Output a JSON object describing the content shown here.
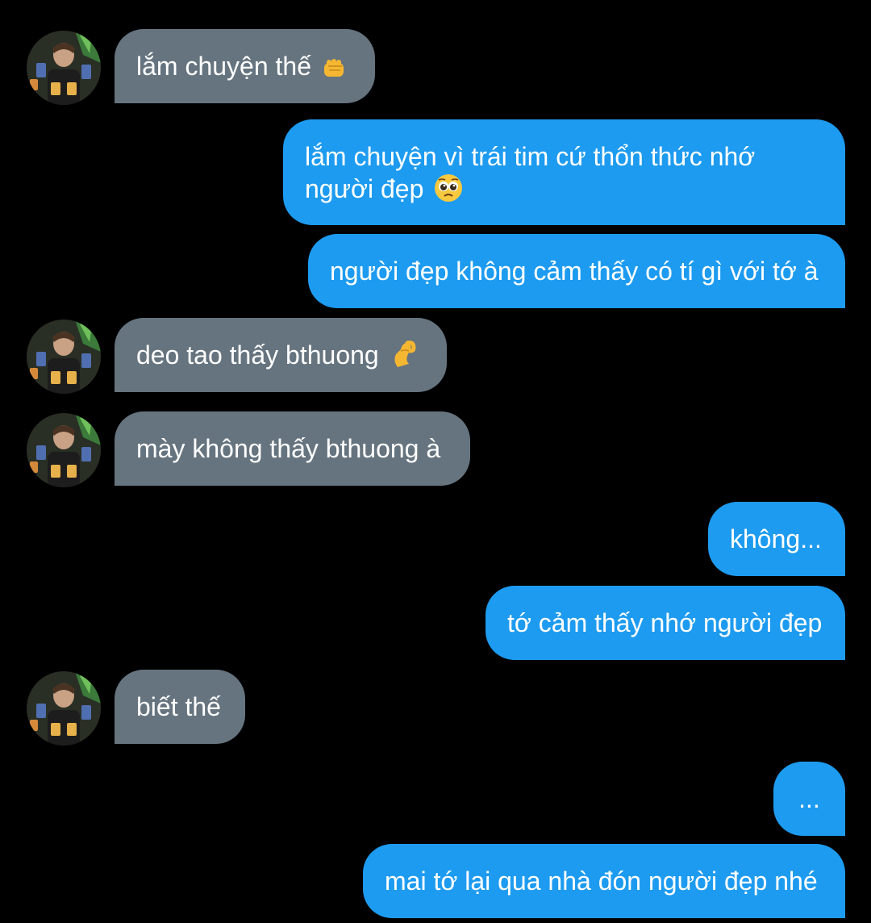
{
  "theme": {
    "background": "#000000",
    "sent_bubble_color": "#1d9bf0",
    "received_bubble_color": "#66747f",
    "text_color": "#ffffff"
  },
  "messages": [
    {
      "from": "them",
      "text": "lắm chuyện thế",
      "emoji": "fist-icon"
    },
    {
      "from": "me",
      "line1": "lắm chuyện vì trái tim cứ thổn thức nhớ",
      "line2": "người đẹp",
      "emoji": "pleading-face-icon"
    },
    {
      "from": "me",
      "text": "người đẹp không cảm thấy có tí gì với tớ à"
    },
    {
      "from": "them",
      "text": "deo tao thấy bthuong",
      "emoji": "pinching-hand-icon"
    },
    {
      "from": "them",
      "text": "mày không thấy bthuong à"
    },
    {
      "from": "me",
      "text": "không..."
    },
    {
      "from": "me",
      "text": "tớ cảm thấy nhớ người đẹp"
    },
    {
      "from": "them",
      "text": "biết thế"
    },
    {
      "from": "me",
      "text": "..."
    },
    {
      "from": "me",
      "text": "mai tớ lại qua nhà đón người đẹp nhé"
    }
  ]
}
